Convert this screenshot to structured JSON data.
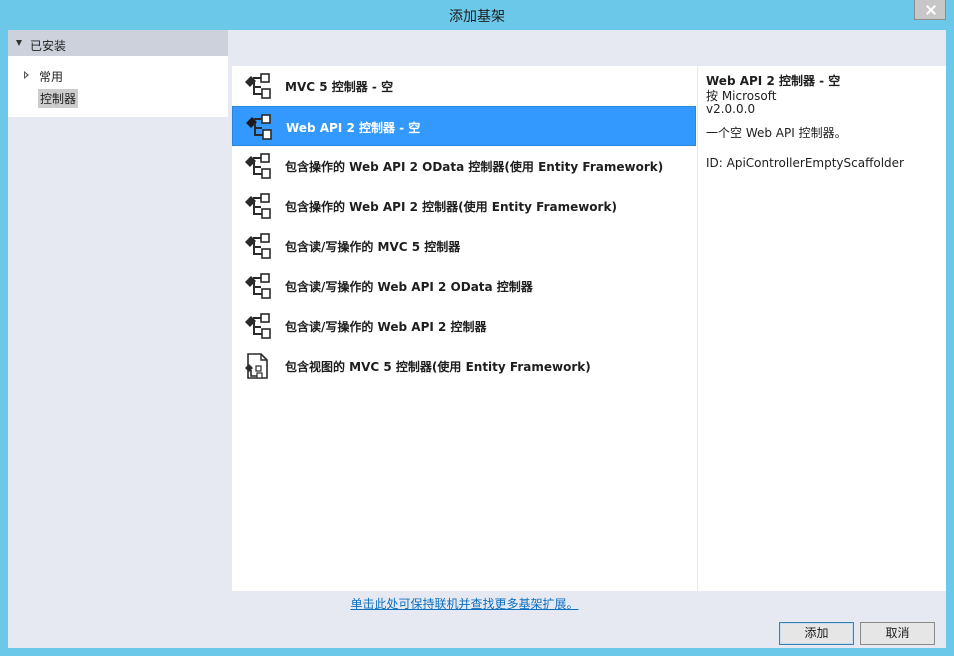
{
  "window": {
    "title": "添加基架"
  },
  "tree": {
    "header": "已安装",
    "items": [
      {
        "label": "常用"
      },
      {
        "label": "控制器"
      }
    ]
  },
  "list": {
    "items": [
      {
        "label": "MVC 5 控制器 - 空",
        "icon": "controller-icon"
      },
      {
        "label": "Web API 2 控制器 - 空",
        "icon": "controller-icon"
      },
      {
        "label": "包含操作的 Web API 2 OData 控制器(使用 Entity Framework)",
        "icon": "controller-icon"
      },
      {
        "label": "包含操作的 Web API 2 控制器(使用 Entity Framework)",
        "icon": "controller-icon"
      },
      {
        "label": "包含读/写操作的 MVC 5 控制器",
        "icon": "controller-icon"
      },
      {
        "label": "包含读/写操作的 Web API 2 OData 控制器",
        "icon": "controller-icon"
      },
      {
        "label": "包含读/写操作的 Web API 2 控制器",
        "icon": "controller-icon"
      },
      {
        "label": "包含视图的 MVC 5 控制器(使用 Entity Framework)",
        "icon": "view-controller-icon"
      }
    ],
    "selected_index": 1,
    "online_link": "单击此处可保持联机并查找更多基架扩展。"
  },
  "details": {
    "name": "Web API 2 控制器 - 空",
    "author": "按 Microsoft",
    "version": "v2.0.0.0",
    "description": "一个空 Web API 控制器。",
    "id": "ID: ApiControllerEmptyScaffolder"
  },
  "buttons": {
    "add": "添加",
    "cancel": "取消"
  },
  "colors": {
    "accent": "#3399ff",
    "titlebar": "#6cc8e8",
    "link": "#0e70c0"
  }
}
